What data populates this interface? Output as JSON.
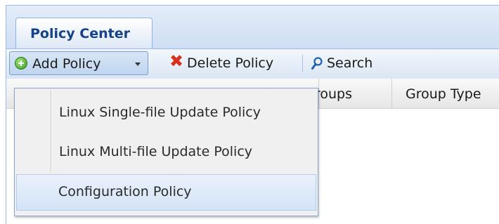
{
  "tabs": [
    {
      "label": "Policy Center"
    }
  ],
  "toolbar": {
    "add_label": "Add Policy",
    "delete_label": "Delete Policy",
    "search_label": "Search"
  },
  "grid": {
    "columns": [
      "roups",
      "Group Type"
    ]
  },
  "menu": {
    "items": [
      {
        "label": "Linux Single-file Update Policy"
      },
      {
        "label": "Linux Multi-file Update Policy"
      },
      {
        "label": "Configuration Policy",
        "highlighted": true
      }
    ]
  },
  "colors": {
    "tab_text": "#15428b",
    "delete_icon": "#d9301c",
    "add_icon": "#3c9a1f",
    "search_icon": "#1e5fb4",
    "menu_highlight": "#d3e3f7"
  },
  "icons": [
    "add-icon",
    "caret-down-icon",
    "delete-icon",
    "search-icon"
  ]
}
